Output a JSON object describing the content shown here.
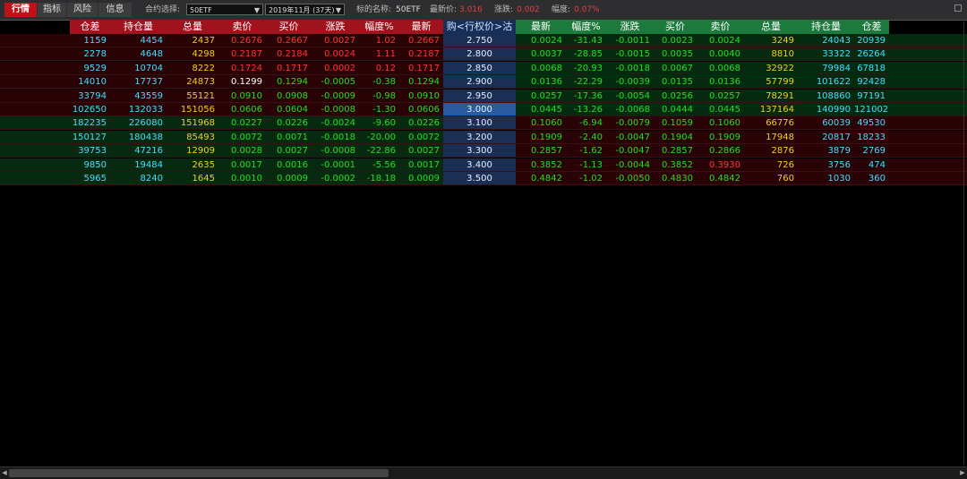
{
  "tabs": [
    {
      "label": "行情",
      "active": true
    },
    {
      "label": "指标",
      "active": false
    },
    {
      "label": "风险",
      "active": false
    },
    {
      "label": "信息",
      "active": false
    }
  ],
  "toolbar": {
    "contract_label": "合约选择:",
    "contract_value": "50ETF",
    "month_value": "2019年11月 (37天)",
    "underlying_label": "标的名称:",
    "underlying_value": "50ETF",
    "latest_label": "最新价:",
    "latest_value": "3.016",
    "change_label": "涨跌:",
    "change_value": "0.002",
    "pct_label": "幅度:",
    "pct_value": "0.07%"
  },
  "headers": {
    "put": [
      "仓差",
      "持仓量",
      "总量",
      "卖价",
      "买价",
      "涨跌",
      "幅度%",
      "最新"
    ],
    "mid": "购<行权价>沽",
    "call": [
      "最新",
      "幅度%",
      "涨跌",
      "买价",
      "卖价",
      "总量",
      "持仓量",
      "仓差"
    ]
  },
  "colors": {
    "put_header": "#a0121c",
    "call_header": "#1b7a3c",
    "row_red_bg": "#2a0306",
    "row_green_bg": "#062a10",
    "strike_bg": "#1b2f55",
    "strike_selected_bg": "#2a5aa0"
  },
  "rows": [
    {
      "left_bg": "red",
      "right_bg": "green",
      "strike": "2.750",
      "selected": false,
      "put": [
        [
          "1159",
          "cyan"
        ],
        [
          "4454",
          "cyan"
        ],
        [
          "2437",
          "yellow"
        ],
        [
          "0.2676",
          "red"
        ],
        [
          "0.2667",
          "red"
        ],
        [
          "0.0027",
          "red"
        ],
        [
          "1.02",
          "red"
        ],
        [
          "0.2667",
          "red"
        ]
      ],
      "call": [
        [
          "0.0024",
          "green"
        ],
        [
          "-31.43",
          "green"
        ],
        [
          "-0.0011",
          "green"
        ],
        [
          "0.0023",
          "green"
        ],
        [
          "0.0024",
          "green"
        ],
        [
          "3249",
          "yellow"
        ],
        [
          "24043",
          "cyan"
        ],
        [
          "20939",
          "cyan"
        ]
      ]
    },
    {
      "left_bg": "red",
      "right_bg": "green",
      "strike": "2.800",
      "selected": false,
      "put": [
        [
          "2278",
          "cyan"
        ],
        [
          "4648",
          "cyan"
        ],
        [
          "4298",
          "yellow"
        ],
        [
          "0.2187",
          "red"
        ],
        [
          "0.2184",
          "red"
        ],
        [
          "0.0024",
          "red"
        ],
        [
          "1.11",
          "red"
        ],
        [
          "0.2187",
          "red"
        ]
      ],
      "call": [
        [
          "0.0037",
          "green"
        ],
        [
          "-28.85",
          "green"
        ],
        [
          "-0.0015",
          "green"
        ],
        [
          "0.0035",
          "green"
        ],
        [
          "0.0040",
          "green"
        ],
        [
          "8810",
          "yellow"
        ],
        [
          "33322",
          "cyan"
        ],
        [
          "26264",
          "cyan"
        ]
      ]
    },
    {
      "left_bg": "red",
      "right_bg": "green",
      "strike": "2.850",
      "selected": false,
      "put": [
        [
          "9529",
          "cyan"
        ],
        [
          "10704",
          "cyan"
        ],
        [
          "8222",
          "yellow"
        ],
        [
          "0.1724",
          "red"
        ],
        [
          "0.1717",
          "red"
        ],
        [
          "0.0002",
          "red"
        ],
        [
          "0.12",
          "red"
        ],
        [
          "0.1717",
          "red"
        ]
      ],
      "call": [
        [
          "0.0068",
          "green"
        ],
        [
          "-20.93",
          "green"
        ],
        [
          "-0.0018",
          "green"
        ],
        [
          "0.0067",
          "green"
        ],
        [
          "0.0068",
          "green"
        ],
        [
          "32922",
          "yellow"
        ],
        [
          "79984",
          "cyan"
        ],
        [
          "67818",
          "cyan"
        ]
      ]
    },
    {
      "left_bg": "red",
      "right_bg": "green",
      "strike": "2.900",
      "selected": false,
      "put": [
        [
          "14010",
          "cyan"
        ],
        [
          "17737",
          "cyan"
        ],
        [
          "24873",
          "yellow"
        ],
        [
          "0.1299",
          "white"
        ],
        [
          "0.1294",
          "green"
        ],
        [
          "-0.0005",
          "green"
        ],
        [
          "-0.38",
          "green"
        ],
        [
          "0.1294",
          "green"
        ]
      ],
      "call": [
        [
          "0.0136",
          "green"
        ],
        [
          "-22.29",
          "green"
        ],
        [
          "-0.0039",
          "green"
        ],
        [
          "0.0135",
          "green"
        ],
        [
          "0.0136",
          "green"
        ],
        [
          "57799",
          "yellow"
        ],
        [
          "101622",
          "cyan"
        ],
        [
          "92428",
          "cyan"
        ]
      ]
    },
    {
      "left_bg": "red",
      "right_bg": "green",
      "strike": "2.950",
      "selected": false,
      "put": [
        [
          "33794",
          "cyan"
        ],
        [
          "43559",
          "cyan"
        ],
        [
          "55121",
          "yellow"
        ],
        [
          "0.0910",
          "green"
        ],
        [
          "0.0908",
          "green"
        ],
        [
          "-0.0009",
          "green"
        ],
        [
          "-0.98",
          "green"
        ],
        [
          "0.0910",
          "green"
        ]
      ],
      "call": [
        [
          "0.0257",
          "green"
        ],
        [
          "-17.36",
          "green"
        ],
        [
          "-0.0054",
          "green"
        ],
        [
          "0.0256",
          "green"
        ],
        [
          "0.0257",
          "green"
        ],
        [
          "78291",
          "yellow"
        ],
        [
          "108860",
          "cyan"
        ],
        [
          "97191",
          "cyan"
        ]
      ]
    },
    {
      "left_bg": "red",
      "right_bg": "green",
      "strike": "3.000",
      "selected": true,
      "put": [
        [
          "102650",
          "cyan"
        ],
        [
          "132033",
          "cyan"
        ],
        [
          "151056",
          "yellow"
        ],
        [
          "0.0606",
          "green"
        ],
        [
          "0.0604",
          "green"
        ],
        [
          "-0.0008",
          "green"
        ],
        [
          "-1.30",
          "green"
        ],
        [
          "0.0606",
          "green"
        ]
      ],
      "call": [
        [
          "0.0445",
          "green"
        ],
        [
          "-13.26",
          "green"
        ],
        [
          "-0.0068",
          "green"
        ],
        [
          "0.0444",
          "green"
        ],
        [
          "0.0445",
          "green"
        ],
        [
          "137164",
          "yellow"
        ],
        [
          "140990",
          "cyan"
        ],
        [
          "121002",
          "cyan"
        ]
      ]
    },
    {
      "left_bg": "green",
      "right_bg": "red",
      "strike": "3.100",
      "selected": false,
      "put": [
        [
          "182235",
          "cyan"
        ],
        [
          "226080",
          "cyan"
        ],
        [
          "151968",
          "yellow"
        ],
        [
          "0.0227",
          "green"
        ],
        [
          "0.0226",
          "green"
        ],
        [
          "-0.0024",
          "green"
        ],
        [
          "-9.60",
          "green"
        ],
        [
          "0.0226",
          "green"
        ]
      ],
      "call": [
        [
          "0.1060",
          "green"
        ],
        [
          "-6.94",
          "green"
        ],
        [
          "-0.0079",
          "green"
        ],
        [
          "0.1059",
          "green"
        ],
        [
          "0.1060",
          "green"
        ],
        [
          "66776",
          "yellow"
        ],
        [
          "60039",
          "cyan"
        ],
        [
          "49530",
          "cyan"
        ]
      ]
    },
    {
      "left_bg": "green",
      "right_bg": "red",
      "strike": "3.200",
      "selected": false,
      "put": [
        [
          "150127",
          "cyan"
        ],
        [
          "180438",
          "cyan"
        ],
        [
          "85493",
          "yellow"
        ],
        [
          "0.0072",
          "green"
        ],
        [
          "0.0071",
          "green"
        ],
        [
          "-0.0018",
          "green"
        ],
        [
          "-20.00",
          "green"
        ],
        [
          "0.0072",
          "green"
        ]
      ],
      "call": [
        [
          "0.1909",
          "green"
        ],
        [
          "-2.40",
          "green"
        ],
        [
          "-0.0047",
          "green"
        ],
        [
          "0.1904",
          "green"
        ],
        [
          "0.1909",
          "green"
        ],
        [
          "17948",
          "yellow"
        ],
        [
          "20817",
          "cyan"
        ],
        [
          "18233",
          "cyan"
        ]
      ]
    },
    {
      "left_bg": "green",
      "right_bg": "red",
      "strike": "3.300",
      "selected": false,
      "put": [
        [
          "39753",
          "cyan"
        ],
        [
          "47216",
          "cyan"
        ],
        [
          "12909",
          "yellow"
        ],
        [
          "0.0028",
          "green"
        ],
        [
          "0.0027",
          "green"
        ],
        [
          "-0.0008",
          "green"
        ],
        [
          "-22.86",
          "green"
        ],
        [
          "0.0027",
          "green"
        ]
      ],
      "call": [
        [
          "0.2857",
          "green"
        ],
        [
          "-1.62",
          "green"
        ],
        [
          "-0.0047",
          "green"
        ],
        [
          "0.2857",
          "green"
        ],
        [
          "0.2866",
          "green"
        ],
        [
          "2876",
          "yellow"
        ],
        [
          "3879",
          "cyan"
        ],
        [
          "2769",
          "cyan"
        ]
      ]
    },
    {
      "left_bg": "green",
      "right_bg": "red",
      "strike": "3.400",
      "selected": false,
      "put": [
        [
          "9850",
          "cyan"
        ],
        [
          "19484",
          "cyan"
        ],
        [
          "2635",
          "yellow"
        ],
        [
          "0.0017",
          "green"
        ],
        [
          "0.0016",
          "green"
        ],
        [
          "-0.0001",
          "green"
        ],
        [
          "-5.56",
          "green"
        ],
        [
          "0.0017",
          "green"
        ]
      ],
      "call": [
        [
          "0.3852",
          "green"
        ],
        [
          "-1.13",
          "green"
        ],
        [
          "-0.0044",
          "green"
        ],
        [
          "0.3852",
          "green"
        ],
        [
          "0.3930",
          "red"
        ],
        [
          "726",
          "yellow"
        ],
        [
          "3756",
          "cyan"
        ],
        [
          "474",
          "cyan"
        ]
      ]
    },
    {
      "left_bg": "green",
      "right_bg": "red",
      "strike": "3.500",
      "selected": false,
      "put": [
        [
          "5965",
          "cyan"
        ],
        [
          "8240",
          "cyan"
        ],
        [
          "1645",
          "yellow"
        ],
        [
          "0.0010",
          "green"
        ],
        [
          "0.0009",
          "green"
        ],
        [
          "-0.0002",
          "green"
        ],
        [
          "-18.18",
          "green"
        ],
        [
          "0.0009",
          "green"
        ]
      ],
      "call": [
        [
          "0.4842",
          "green"
        ],
        [
          "-1.02",
          "green"
        ],
        [
          "-0.0050",
          "green"
        ],
        [
          "0.4830",
          "green"
        ],
        [
          "0.4842",
          "green"
        ],
        [
          "760",
          "yellow"
        ],
        [
          "1030",
          "cyan"
        ],
        [
          "360",
          "cyan"
        ]
      ]
    }
  ]
}
